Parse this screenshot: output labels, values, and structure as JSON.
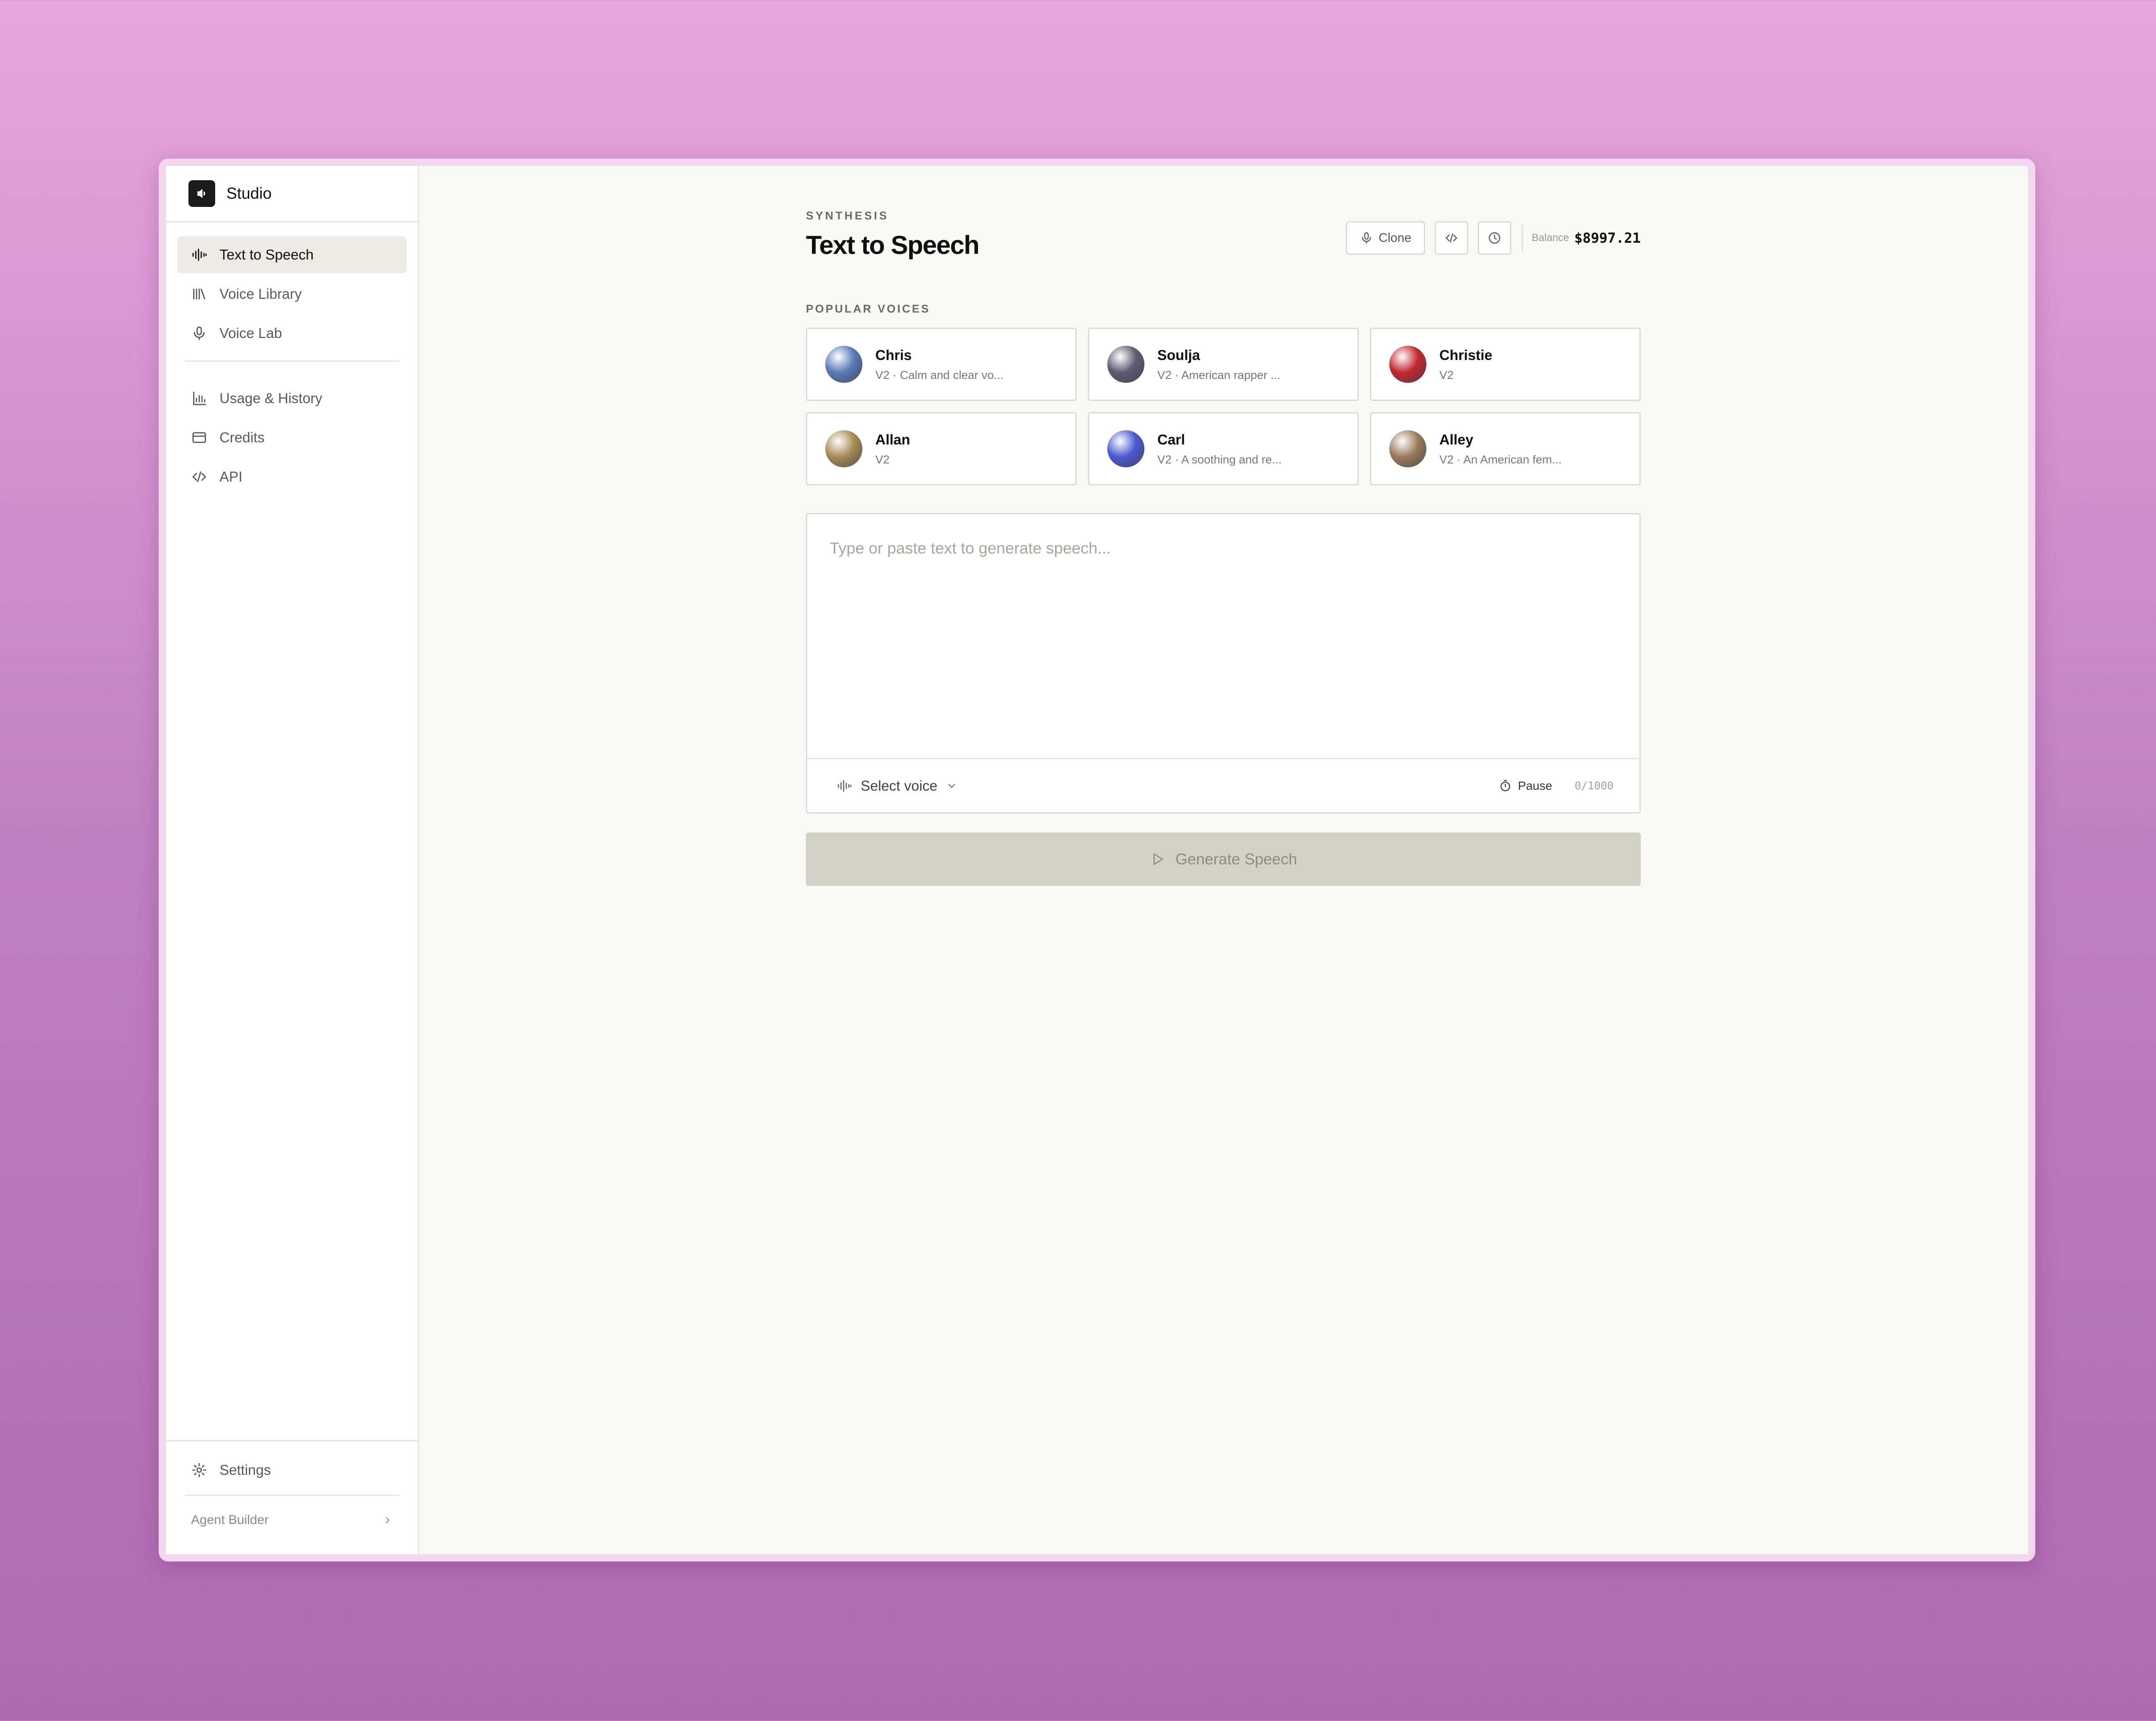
{
  "app": {
    "name": "Studio"
  },
  "sidebar": {
    "items": [
      {
        "label": "Text to Speech",
        "icon": "waveform-icon",
        "active": true
      },
      {
        "label": "Voice Library",
        "icon": "library-icon"
      },
      {
        "label": "Voice Lab",
        "icon": "microphone-icon"
      },
      {
        "label": "Usage & History",
        "icon": "bar-chart-icon"
      },
      {
        "label": "Credits",
        "icon": "credit-card-icon"
      },
      {
        "label": "API",
        "icon": "code-icon"
      }
    ],
    "settings_label": "Settings",
    "agent_label": "Agent Builder"
  },
  "header": {
    "eyebrow": "SYNTHESIS",
    "title": "Text to Speech",
    "clone_label": "Clone",
    "balance_label": "Balance",
    "balance_value": "$8997.21"
  },
  "voices": {
    "section_label": "POPULAR VOICES",
    "items": [
      {
        "name": "Chris",
        "desc": "V2 · Calm and clear vo...",
        "color": "#5a7ab8"
      },
      {
        "name": "Soulja",
        "desc": "V2 · American rapper ...",
        "color": "#5e5a72"
      },
      {
        "name": "Christie",
        "desc": "V2",
        "color": "#c0282e"
      },
      {
        "name": "Allan",
        "desc": "V2",
        "color": "#a88a55"
      },
      {
        "name": "Carl",
        "desc": "V2 · A soothing and re...",
        "color": "#4a58d0"
      },
      {
        "name": "Alley",
        "desc": "V2 · An American fem...",
        "color": "#9a7a5a"
      }
    ]
  },
  "editor": {
    "placeholder": "Type or paste text to generate speech...",
    "select_voice_label": "Select voice",
    "pause_label": "Pause",
    "char_count": "0/1000"
  },
  "generate": {
    "label": "Generate Speech"
  }
}
